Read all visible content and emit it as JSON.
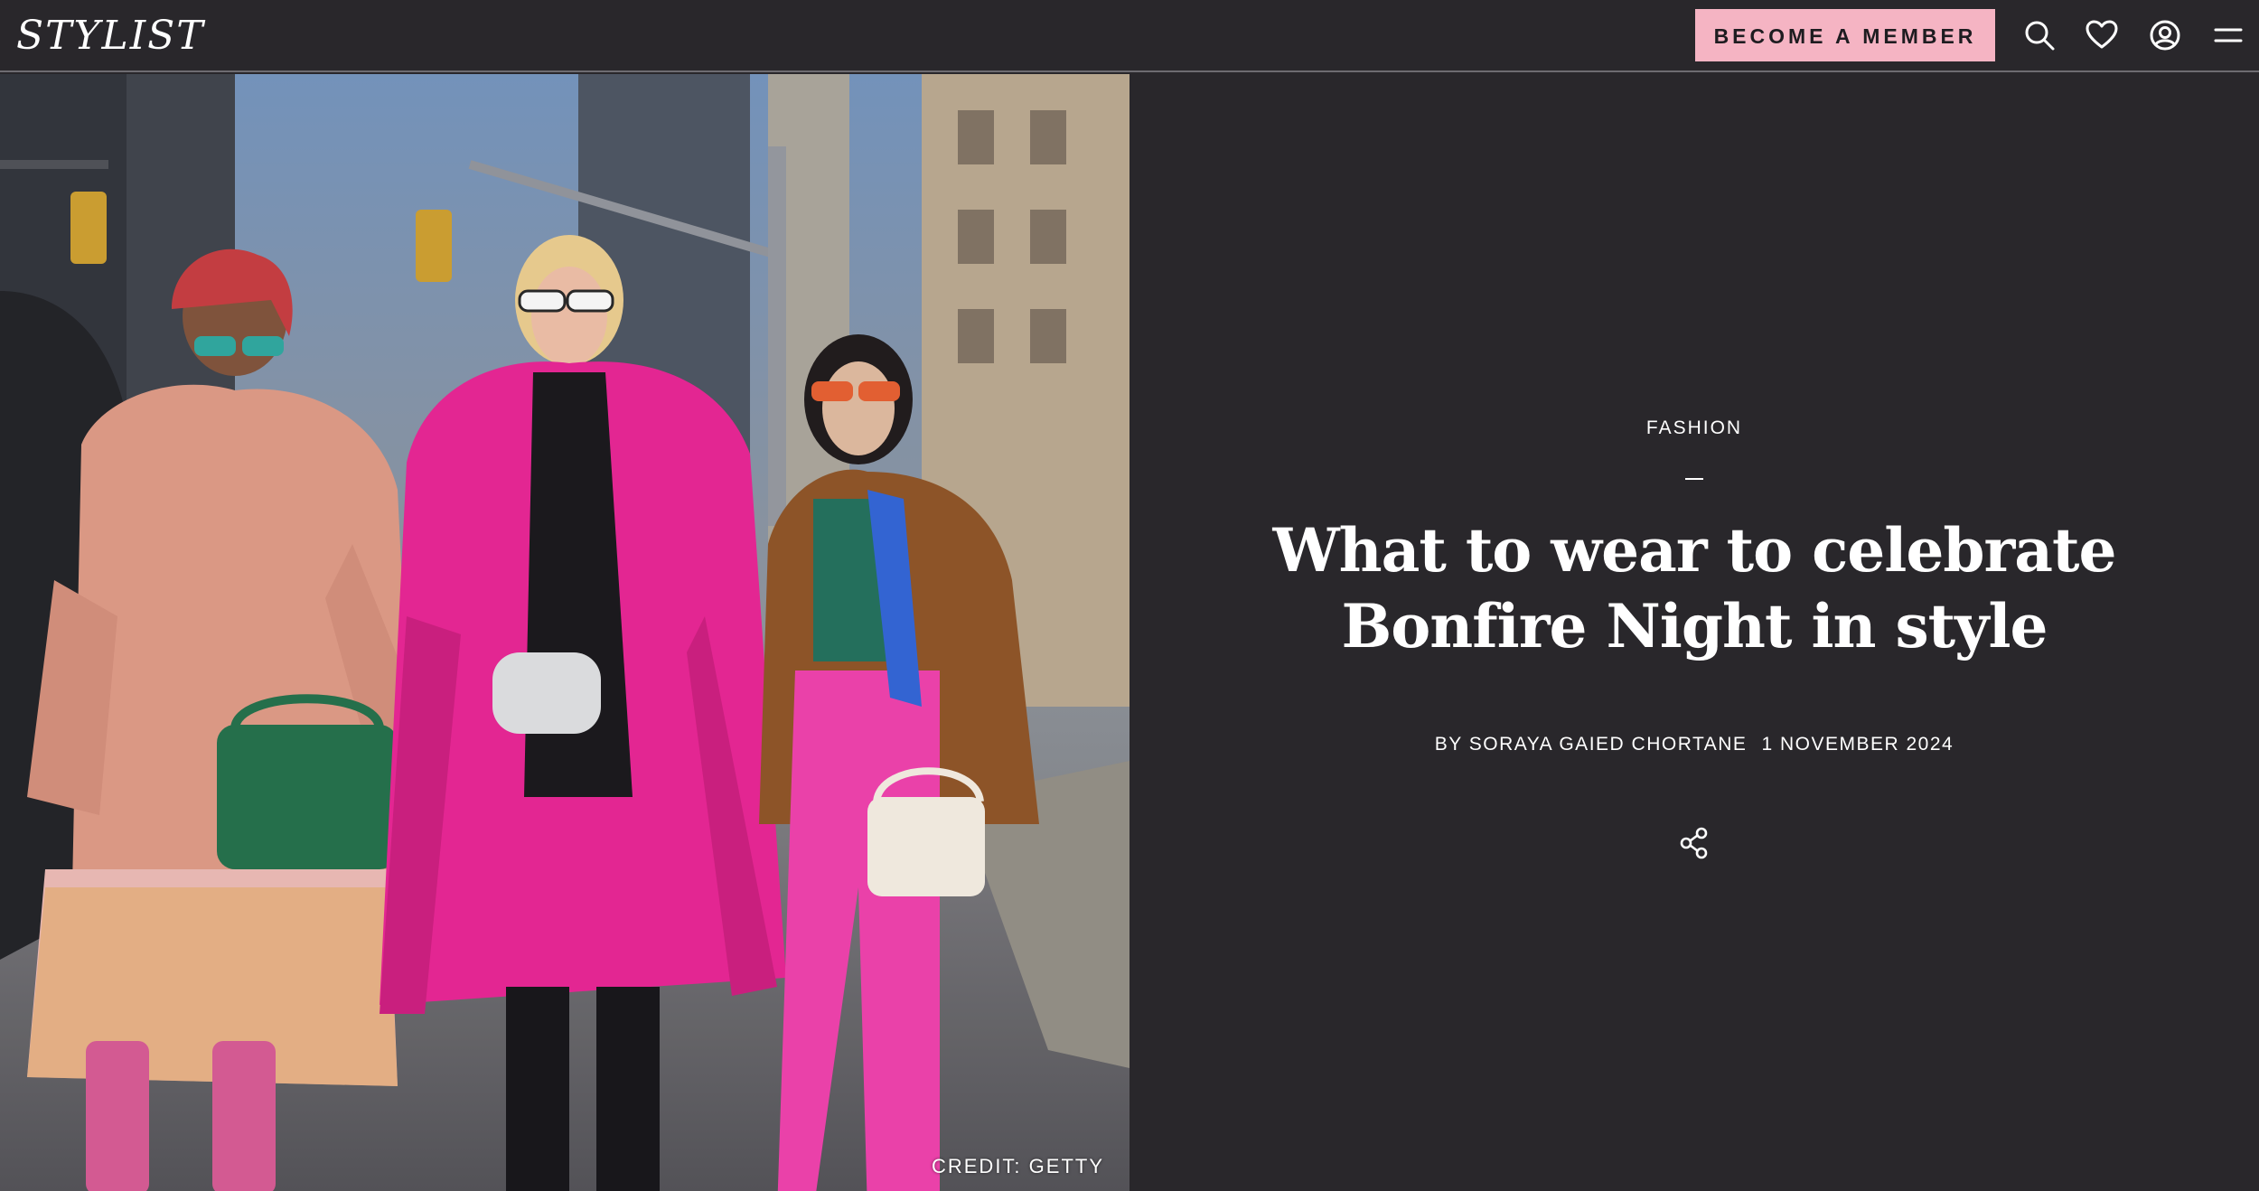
{
  "header": {
    "logo": "STYLIST",
    "member_button": "BECOME A MEMBER",
    "icons": [
      "search-icon",
      "heart-icon",
      "account-icon",
      "menu-icon"
    ]
  },
  "hero": {
    "credit": "CREDIT: GETTY"
  },
  "article": {
    "category": "FASHION",
    "title_line1": "What to wear to celebrate",
    "title_line2": "Bonfire Night in style",
    "author": "BY SORAYA GAIED CHORTANE",
    "date": "1 NOVEMBER 2024",
    "share_icon": "share-icon"
  },
  "colors": {
    "background": "#29272b",
    "accent_button": "#f5b4c3",
    "text": "#ffffff"
  }
}
